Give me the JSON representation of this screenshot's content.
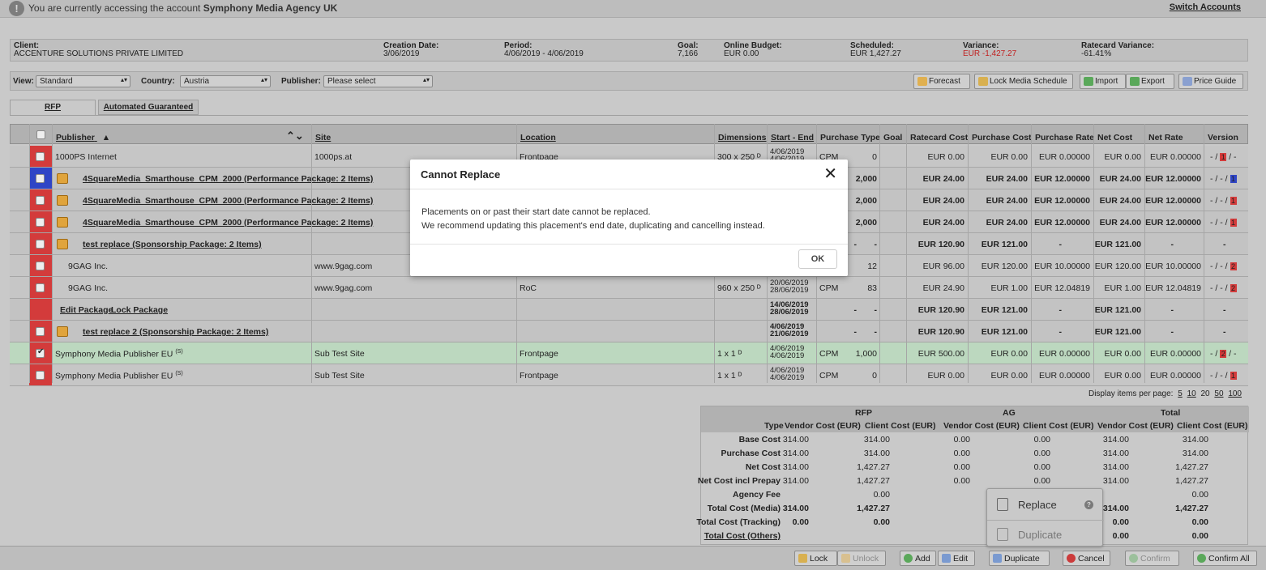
{
  "notice": {
    "text_prefix": "You are currently accessing the account",
    "account": "Symphony Media Agency UK",
    "switch_label": "Switch Accounts"
  },
  "summary": {
    "client_label": "Client:",
    "client": "ACCENTURE SOLUTIONS PRIVATE LIMITED",
    "creation_label": "Creation Date:",
    "creation": "3/06/2019",
    "period_label": "Period:",
    "period": "4/06/2019 - 4/06/2019",
    "goal_label": "Goal:",
    "goal": "7,166",
    "online_budget_label": "Online Budget:",
    "online_budget": "EUR 0.00",
    "scheduled_label": "Scheduled:",
    "scheduled": "EUR 1,427.27",
    "variance_label": "Variance:",
    "variance": "EUR -1,427.27",
    "ratecard_variance_label": "Ratecard Variance:",
    "ratecard_variance": "-61.41%"
  },
  "filters": {
    "view_label": "View:",
    "view_value": "Standard",
    "country_label": "Country:",
    "country_value": "Austria",
    "publisher_label": "Publisher:",
    "publisher_value": "Please select",
    "buttons": {
      "forecast": "Forecast",
      "lock_schedule": "Lock Media Schedule",
      "import": "Import",
      "export": "Export",
      "price_guide": "Price Guide"
    }
  },
  "tabs": [
    "RFP",
    "Automated Guaranteed"
  ],
  "columns": {
    "publisher": "Publisher",
    "sort_arrow": "▲",
    "site": "Site",
    "location": "Location",
    "dimensions": "Dimensions",
    "start_end": "Start - End",
    "purchase_type": "Purchase Type",
    "goal": "Goal",
    "ratecard_cost": "Ratecard Cost",
    "purchase_cost": "Purchase Cost",
    "purchase_rate": "Purchase Rate",
    "net_cost": "Net Cost",
    "net_rate": "Net Rate",
    "version": "Version"
  },
  "rows": [
    {
      "publisher": "1000PS Internet",
      "site": "1000ps.at",
      "location": "Frontpage",
      "dim": "300 x 250 ᴰ",
      "start": "4/06/2019",
      "end": "4/06/2019",
      "ptype": "CPM",
      "goal": "0",
      "rc": "EUR 0.00",
      "pc": "EUR 0.00",
      "pr": "EUR 0.00000",
      "nc": "EUR 0.00",
      "nr": "EUR 0.00000",
      "ver_a": "- / ",
      "ver_m": "1",
      "ver_b": " / -"
    },
    {
      "publisher": "4SquareMedia_Smarthouse_CPM_2000 (Performance Package: 2 Items)",
      "goal": "2,000",
      "rc": "EUR 24.00",
      "pc": "EUR 24.00",
      "pr": "EUR 12.00000",
      "nc": "EUR 24.00",
      "nr": "EUR 12.00000",
      "ver_a": "- / - / ",
      "ver_m": "1",
      "ver_b": ""
    },
    {
      "publisher": "4SquareMedia_Smarthouse_CPM_2000 (Performance Package: 2 Items)",
      "goal": "2,000",
      "rc": "EUR 24.00",
      "pc": "EUR 24.00",
      "pr": "EUR 12.00000",
      "nc": "EUR 24.00",
      "nr": "EUR 12.00000",
      "ver_a": "- / - / ",
      "ver_m": "1",
      "ver_b": ""
    },
    {
      "publisher": "4SquareMedia_Smarthouse_CPM_2000 (Performance Package: 2 Items)",
      "goal": "2,000",
      "rc": "EUR 24.00",
      "pc": "EUR 24.00",
      "pr": "EUR 12.00000",
      "nc": "EUR 24.00",
      "nr": "EUR 12.00000",
      "ver_a": "- / - / ",
      "ver_m": "1",
      "ver_b": ""
    },
    {
      "publisher": "test replace (Sponsorship Package: 2 Items)",
      "ptype": "-",
      "goal": "-",
      "rc": "EUR 120.90",
      "pc": "EUR 121.00",
      "pr": "-",
      "nc": "EUR 121.00",
      "nr": "-",
      "ver": "-"
    },
    {
      "publisher": "9GAG Inc.",
      "site": "www.9gag.com",
      "goal": "12",
      "rc": "EUR 96.00",
      "pc": "EUR 120.00",
      "pr": "EUR 10.00000",
      "nc": "EUR 120.00",
      "nr": "EUR 10.00000",
      "ver_a": "- / - / ",
      "ver_m": "2",
      "ver_b": ""
    },
    {
      "publisher": "9GAG Inc.",
      "site": "www.9gag.com",
      "location": "RoC",
      "dim": "960 x 250 ᴰ",
      "start": "20/06/2019",
      "end": "28/06/2019",
      "ptype": "CPM",
      "goal": "83",
      "rc": "EUR 24.90",
      "pc": "EUR 1.00",
      "pr": "EUR 12.04819",
      "nc": "EUR 1.00",
      "nr": "EUR 12.04819",
      "ver_a": "- / - / ",
      "ver_m": "2",
      "ver_b": ""
    },
    {
      "edit_pkg": "Edit Package",
      "lock_pkg": "Lock Package",
      "start": "14/06/2019",
      "end": "28/06/2019",
      "ptype": "-",
      "goal": "-",
      "rc": "EUR 120.90",
      "pc": "EUR 121.00",
      "pr": "-",
      "nc": "EUR 121.00",
      "nr": "-",
      "ver": "-"
    },
    {
      "publisher": "test replace 2 (Sponsorship Package: 2 Items)",
      "start": "4/06/2019",
      "end": "21/06/2019",
      "ptype": "-",
      "goal": "-",
      "rc": "EUR 120.90",
      "pc": "EUR 121.00",
      "pr": "-",
      "nc": "EUR 121.00",
      "nr": "-",
      "ver": "-"
    },
    {
      "publisher": "Symphony Media Publisher EU",
      "sup": "(S)",
      "site": "Sub Test Site",
      "location": "Frontpage",
      "dim": "1 x 1 ᴰ",
      "start": "4/06/2019",
      "end": "4/06/2019",
      "ptype": "CPM",
      "goal": "1,000",
      "rc": "EUR 500.00",
      "pc": "EUR 0.00",
      "pr": "EUR 0.00000",
      "nc": "EUR 0.00",
      "nr": "EUR 0.00000",
      "ver_a": "- / ",
      "ver_m": "2",
      "ver_b": " / -"
    },
    {
      "publisher": "Symphony Media Publisher EU",
      "sup": "(S)",
      "site": "Sub Test Site",
      "location": "Frontpage",
      "dim": "1 x 1 ᴰ",
      "start": "4/06/2019",
      "end": "4/06/2019",
      "ptype": "CPM",
      "goal": "0",
      "rc": "EUR 0.00",
      "pc": "EUR 0.00",
      "pr": "EUR 0.00000",
      "nc": "EUR 0.00",
      "nr": "EUR 0.00000",
      "ver_a": "- / - / ",
      "ver_m": "1",
      "ver_b": ""
    }
  ],
  "per_page": {
    "label": "Display items per page:",
    "options": [
      "5",
      "10",
      "20",
      "50",
      "100"
    ]
  },
  "totals": {
    "groups": [
      "RFP",
      "AG",
      "Total"
    ],
    "type_label": "Type",
    "subheads": [
      "Vendor Cost (EUR)",
      "Client Cost (EUR)",
      "Vendor Cost (EUR)",
      "Client Cost (EUR)",
      "Vendor Cost (EUR)",
      "Client Cost (EUR)"
    ],
    "rows": [
      {
        "label": "Base Cost",
        "v": [
          "314.00",
          "314.00",
          "0.00",
          "0.00",
          "314.00",
          "314.00"
        ]
      },
      {
        "label": "Purchase Cost",
        "v": [
          "314.00",
          "314.00",
          "0.00",
          "0.00",
          "314.00",
          "314.00"
        ]
      },
      {
        "label": "Net Cost",
        "v": [
          "314.00",
          "1,427.27",
          "0.00",
          "0.00",
          "314.00",
          "1,427.27"
        ]
      },
      {
        "label": "Net Cost incl Prepay",
        "v": [
          "314.00",
          "1,427.27",
          "0.00",
          "0.00",
          "314.00",
          "1,427.27"
        ]
      },
      {
        "label": "Agency Fee",
        "v": [
          "",
          "0.00",
          "",
          "",
          "",
          "0.00"
        ]
      },
      {
        "label": "Total Cost (Media)",
        "v": [
          "314.00",
          "1,427.27",
          "",
          "",
          "314.00",
          "1,427.27"
        ]
      },
      {
        "label": "Total Cost (Tracking)",
        "v": [
          "0.00",
          "0.00",
          "",
          "",
          "0.00",
          "0.00"
        ]
      },
      {
        "label": "Total Cost (Others)",
        "v": [
          "",
          "",
          "",
          "",
          "0.00",
          "0.00"
        ]
      }
    ]
  },
  "actions": {
    "lock": "Lock",
    "unlock": "Unlock",
    "add": "Add",
    "edit": "Edit",
    "duplicate": "Duplicate",
    "cancel": "Cancel",
    "confirm": "Confirm",
    "confirm_all": "Confirm All"
  },
  "dropdown": {
    "replace": "Replace",
    "duplicate": "Duplicate"
  },
  "modal": {
    "title": "Cannot Replace",
    "line1": "Placements on or past their start date cannot be replaced.",
    "line2": "We recommend updating this placement's end date, duplicating and cancelling instead.",
    "ok": "OK"
  },
  "colors": {
    "flag_red": "#d33b3b",
    "flag_blue": "#2f45c6",
    "selected_row": "#bcd8bf",
    "variance_negative": "#c02020"
  }
}
